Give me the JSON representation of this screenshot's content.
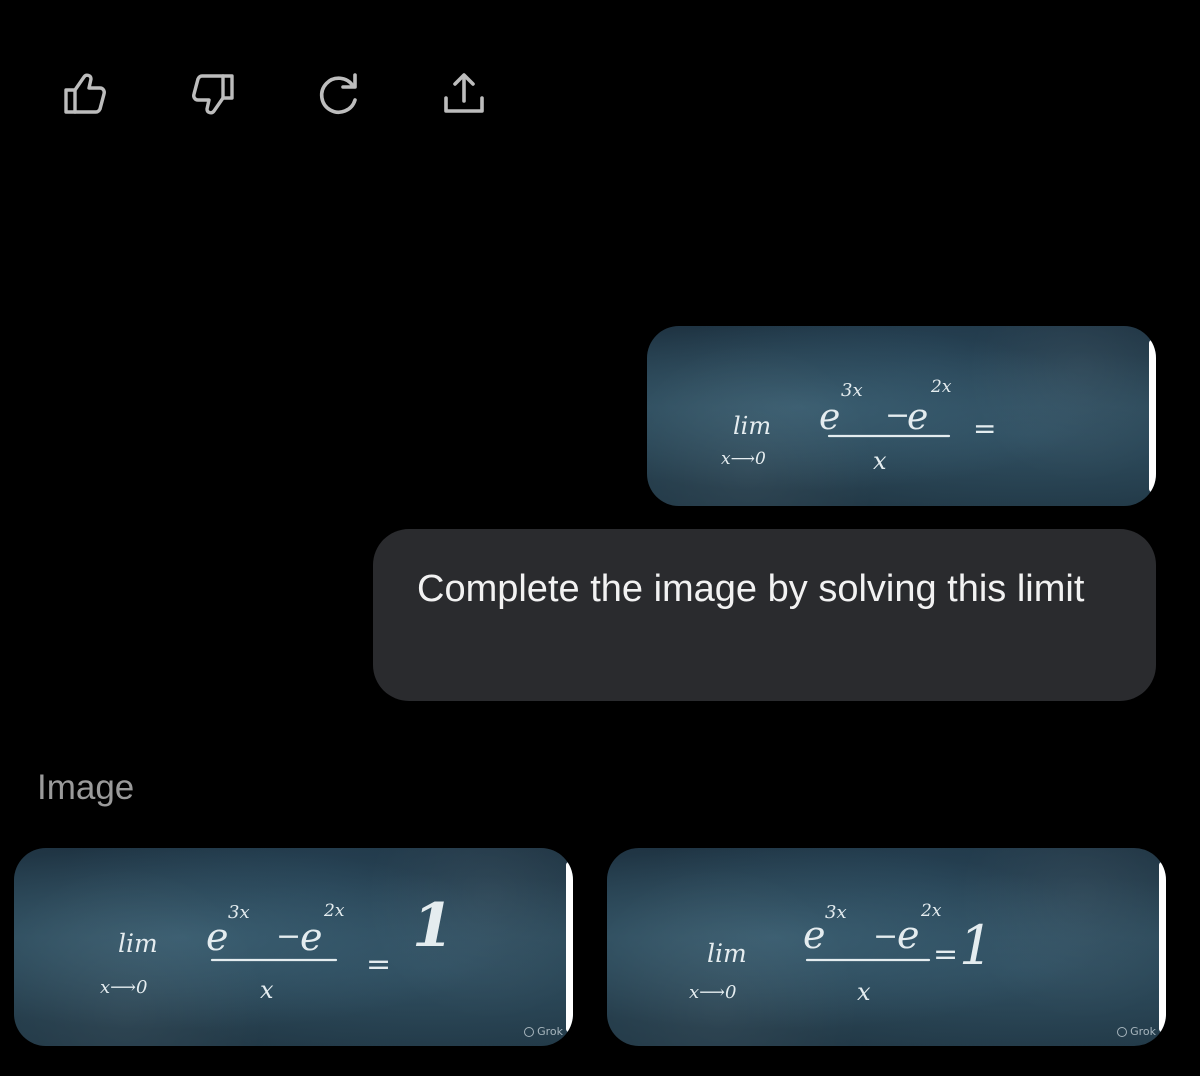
{
  "toolbar": {
    "actions": [
      {
        "name": "like",
        "icon": "thumbs-up-icon"
      },
      {
        "name": "dislike",
        "icon": "thumbs-down-icon"
      },
      {
        "name": "regenerate",
        "icon": "refresh-icon"
      },
      {
        "name": "share",
        "icon": "share-icon"
      }
    ]
  },
  "prompt_image": {
    "lim": "lim",
    "subscript": "x⟶0",
    "numerator_base1": "e",
    "numerator_exp1": "3x",
    "numerator_op": "−",
    "numerator_base2": "e",
    "numerator_exp2": "2x",
    "denominator": "x",
    "equals": "="
  },
  "user_message": {
    "text": "Complete the image by solving this limit"
  },
  "section": {
    "label": "Image"
  },
  "results": [
    {
      "answer": "1",
      "watermark": "Grok"
    },
    {
      "answer": "1",
      "watermark": "Grok"
    }
  ],
  "colors": {
    "background": "#000000",
    "bubble": "#2a2b2e",
    "icon": "#bdbdbd",
    "label": "#9a9a9a"
  }
}
